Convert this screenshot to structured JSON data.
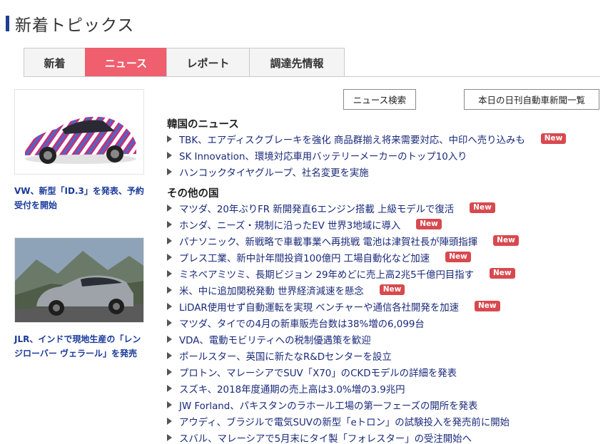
{
  "page": {
    "title": "新着トピックス"
  },
  "tabs": [
    {
      "label": "新着",
      "active": false
    },
    {
      "label": "ニュース",
      "active": true
    },
    {
      "label": "レポート",
      "active": false
    },
    {
      "label": "調達先情報",
      "active": false
    }
  ],
  "buttons": {
    "news_search": "ニュース検索",
    "daily_papers": "本日の日刊自動車新聞一覧"
  },
  "features": [
    {
      "caption": "VW、新型「ID.3」を発表、予約受付を開始"
    },
    {
      "caption": "JLR、インドで現地生産の「レンジローバー ヴェラール」を発売"
    }
  ],
  "badge_label": "New",
  "sections": [
    {
      "title": "韓国のニュース",
      "items": [
        {
          "text": "TBK、エアディスクブレーキを強化 商品群揃え将来需要対応、中印へ売り込みも",
          "new": true
        },
        {
          "text": "SK Innovation、環境対応車用バッテリーメーカーのトップ10入り",
          "new": false
        },
        {
          "text": "ハンコックタイヤグループ、社名変更を実施",
          "new": false
        }
      ]
    },
    {
      "title": "その他の国",
      "items": [
        {
          "text": "マツダ、20年ぶりFR 新開発直6エンジン搭載 上級モデルで復活",
          "new": true
        },
        {
          "text": "ホンダ、ニーズ・規制に沿ったEV 世界3地域に導入",
          "new": true
        },
        {
          "text": "パナソニック、新戦略で車載事業へ再挑戦 電池は津賀社長が陣頭指揮",
          "new": true
        },
        {
          "text": "プレス工業、新中計年間投資100億円 工場自動化など加速",
          "new": true
        },
        {
          "text": "ミネベアミツミ、長期ビジョン 29年めどに売上高2兆5千億円目指す",
          "new": true
        },
        {
          "text": "米、中に追加関税発動 世界経済減速を懸念",
          "new": true
        },
        {
          "text": "LiDAR使用せず自動運転を実現 ベンチャーや通信各社開発を加速",
          "new": true
        },
        {
          "text": "マツダ、タイでの4月の新車販売台数は38%増の6,099台",
          "new": false
        },
        {
          "text": "VDA、電動モビリティへの税制優遇策を歓迎",
          "new": false
        },
        {
          "text": "ポールスター、英国に新たなR&Dセンターを設立",
          "new": false
        },
        {
          "text": "プロトン、マレーシアでSUV「X70」のCKDモデルの詳細を発表",
          "new": false
        },
        {
          "text": "スズキ、2018年度通期の売上高は3.0%増の3.9兆円",
          "new": false
        },
        {
          "text": "JW Forland、パキスタンのラホール工場の第一フェーズの開所を発表",
          "new": false
        },
        {
          "text": "アウディ、ブラジルで電気SUVの新型「eトロン」の試験投入を発売前に開始",
          "new": false
        },
        {
          "text": "スバル、マレーシアで5月末にタイ製「フォレスター」の受注開始へ",
          "new": false
        }
      ]
    }
  ]
}
